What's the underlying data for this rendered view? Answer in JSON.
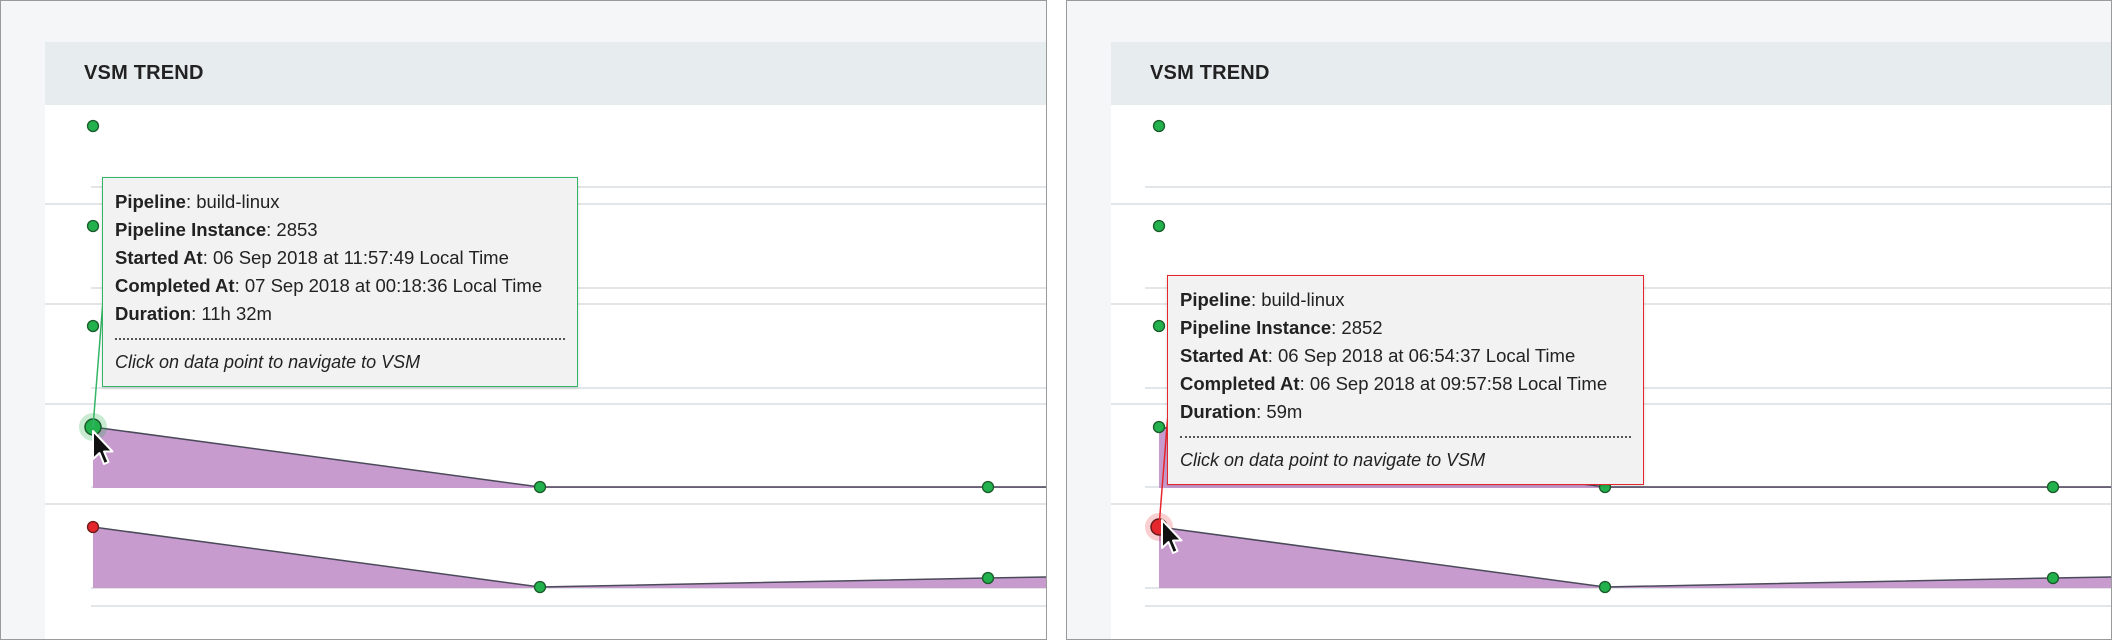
{
  "colors": {
    "success_point": "#22b14c",
    "failed_point": "#e5262c",
    "area_fill": "#c89bcf",
    "tooltip_success_border": "#34b566",
    "tooltip_failed_border": "#e5262c"
  },
  "panels": [
    {
      "title": "VSM TREND",
      "tooltip": {
        "status": "passed",
        "pipeline_label": "Pipeline",
        "pipeline_value": "build-linux",
        "instance_label": "Pipeline Instance",
        "instance_value": "2853",
        "started_label": "Started At",
        "started_value": "06 Sep 2018 at 11:57:49 Local Time",
        "completed_label": "Completed At",
        "completed_value": "07 Sep 2018 at 00:18:36 Local Time",
        "duration_label": "Duration",
        "duration_value": "11h 32m",
        "hint": "Click on data point to navigate to VSM"
      }
    },
    {
      "title": "VSM TREND",
      "tooltip": {
        "status": "failed",
        "pipeline_label": "Pipeline",
        "pipeline_value": "build-linux",
        "instance_label": "Pipeline Instance",
        "instance_value": "2852",
        "started_label": "Started At",
        "started_value": "06 Sep 2018 at 06:54:37 Local Time",
        "completed_label": "Completed At",
        "completed_value": "06 Sep 2018 at 09:57:58 Local Time",
        "duration_label": "Duration",
        "duration_value": "59m",
        "hint": "Click on data point to navigate to VSM"
      }
    }
  ]
}
